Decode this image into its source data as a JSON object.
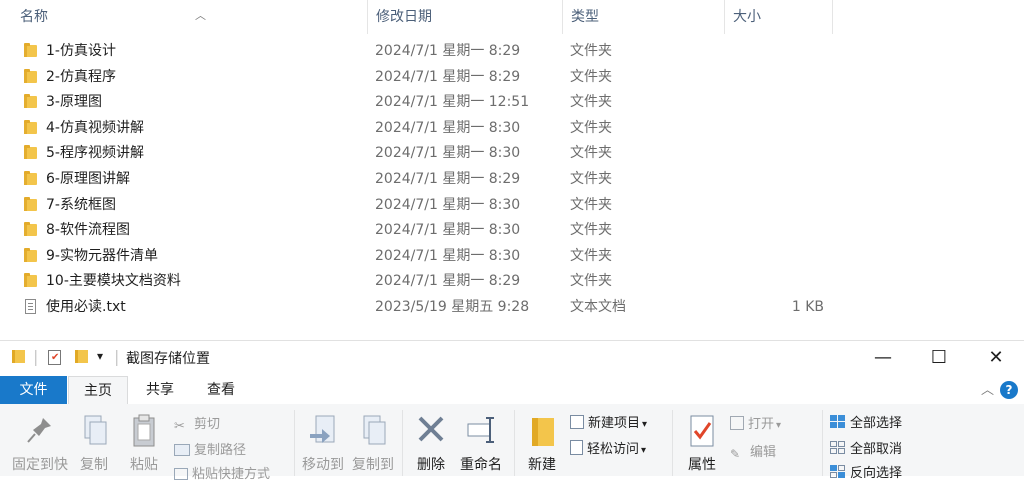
{
  "columns": {
    "name": "名称",
    "date": "修改日期",
    "type": "类型",
    "size": "大小"
  },
  "files": [
    {
      "name": "1-仿真设计",
      "date": "2024/7/1 星期一 8:29",
      "type": "文件夹",
      "size": "",
      "icon": "folder-icon"
    },
    {
      "name": "2-仿真程序",
      "date": "2024/7/1 星期一 8:29",
      "type": "文件夹",
      "size": "",
      "icon": "folder-icon"
    },
    {
      "name": "3-原理图",
      "date": "2024/7/1 星期一 12:51",
      "type": "文件夹",
      "size": "",
      "icon": "folder-icon"
    },
    {
      "name": "4-仿真视频讲解",
      "date": "2024/7/1 星期一 8:30",
      "type": "文件夹",
      "size": "",
      "icon": "folder-icon"
    },
    {
      "name": "5-程序视频讲解",
      "date": "2024/7/1 星期一 8:30",
      "type": "文件夹",
      "size": "",
      "icon": "folder-icon"
    },
    {
      "name": "6-原理图讲解",
      "date": "2024/7/1 星期一 8:29",
      "type": "文件夹",
      "size": "",
      "icon": "folder-icon"
    },
    {
      "name": "7-系统框图",
      "date": "2024/7/1 星期一 8:30",
      "type": "文件夹",
      "size": "",
      "icon": "folder-icon"
    },
    {
      "name": "8-软件流程图",
      "date": "2024/7/1 星期一 8:30",
      "type": "文件夹",
      "size": "",
      "icon": "folder-icon"
    },
    {
      "name": "9-实物元器件清单",
      "date": "2024/7/1 星期一 8:30",
      "type": "文件夹",
      "size": "",
      "icon": "folder-icon"
    },
    {
      "name": "10-主要模块文档资料",
      "date": "2024/7/1 星期一 8:29",
      "type": "文件夹",
      "size": "",
      "icon": "folder-icon"
    },
    {
      "name": "使用必读.txt",
      "date": "2023/5/19 星期五 9:28",
      "type": "文本文档",
      "size": "1 KB",
      "icon": "text-file-icon"
    }
  ],
  "window": {
    "title": "截图存储位置",
    "minimize": "—",
    "maximize": "☐",
    "close": "✕"
  },
  "tabs": {
    "file": "文件",
    "home": "主页",
    "share": "共享",
    "view": "查看"
  },
  "ribbon": {
    "pin": "固定到快",
    "copy": "复制",
    "paste": "粘贴",
    "cut": "剪切",
    "copy_path": "复制路径",
    "paste_shortcut": "粘贴快捷方式",
    "move_to": "移动到",
    "copy_to": "复制到",
    "delete": "删除",
    "rename": "重命名",
    "new_folder": "新建",
    "new_item": "新建项目",
    "easy_access": "轻松访问",
    "properties": "属性",
    "open": "打开",
    "edit": "编辑",
    "select_all": "全部选择",
    "select_none": "全部取消",
    "invert_selection": "反向选择"
  },
  "colors": {
    "accent": "#1979ca",
    "folder": "#f3c54b"
  }
}
